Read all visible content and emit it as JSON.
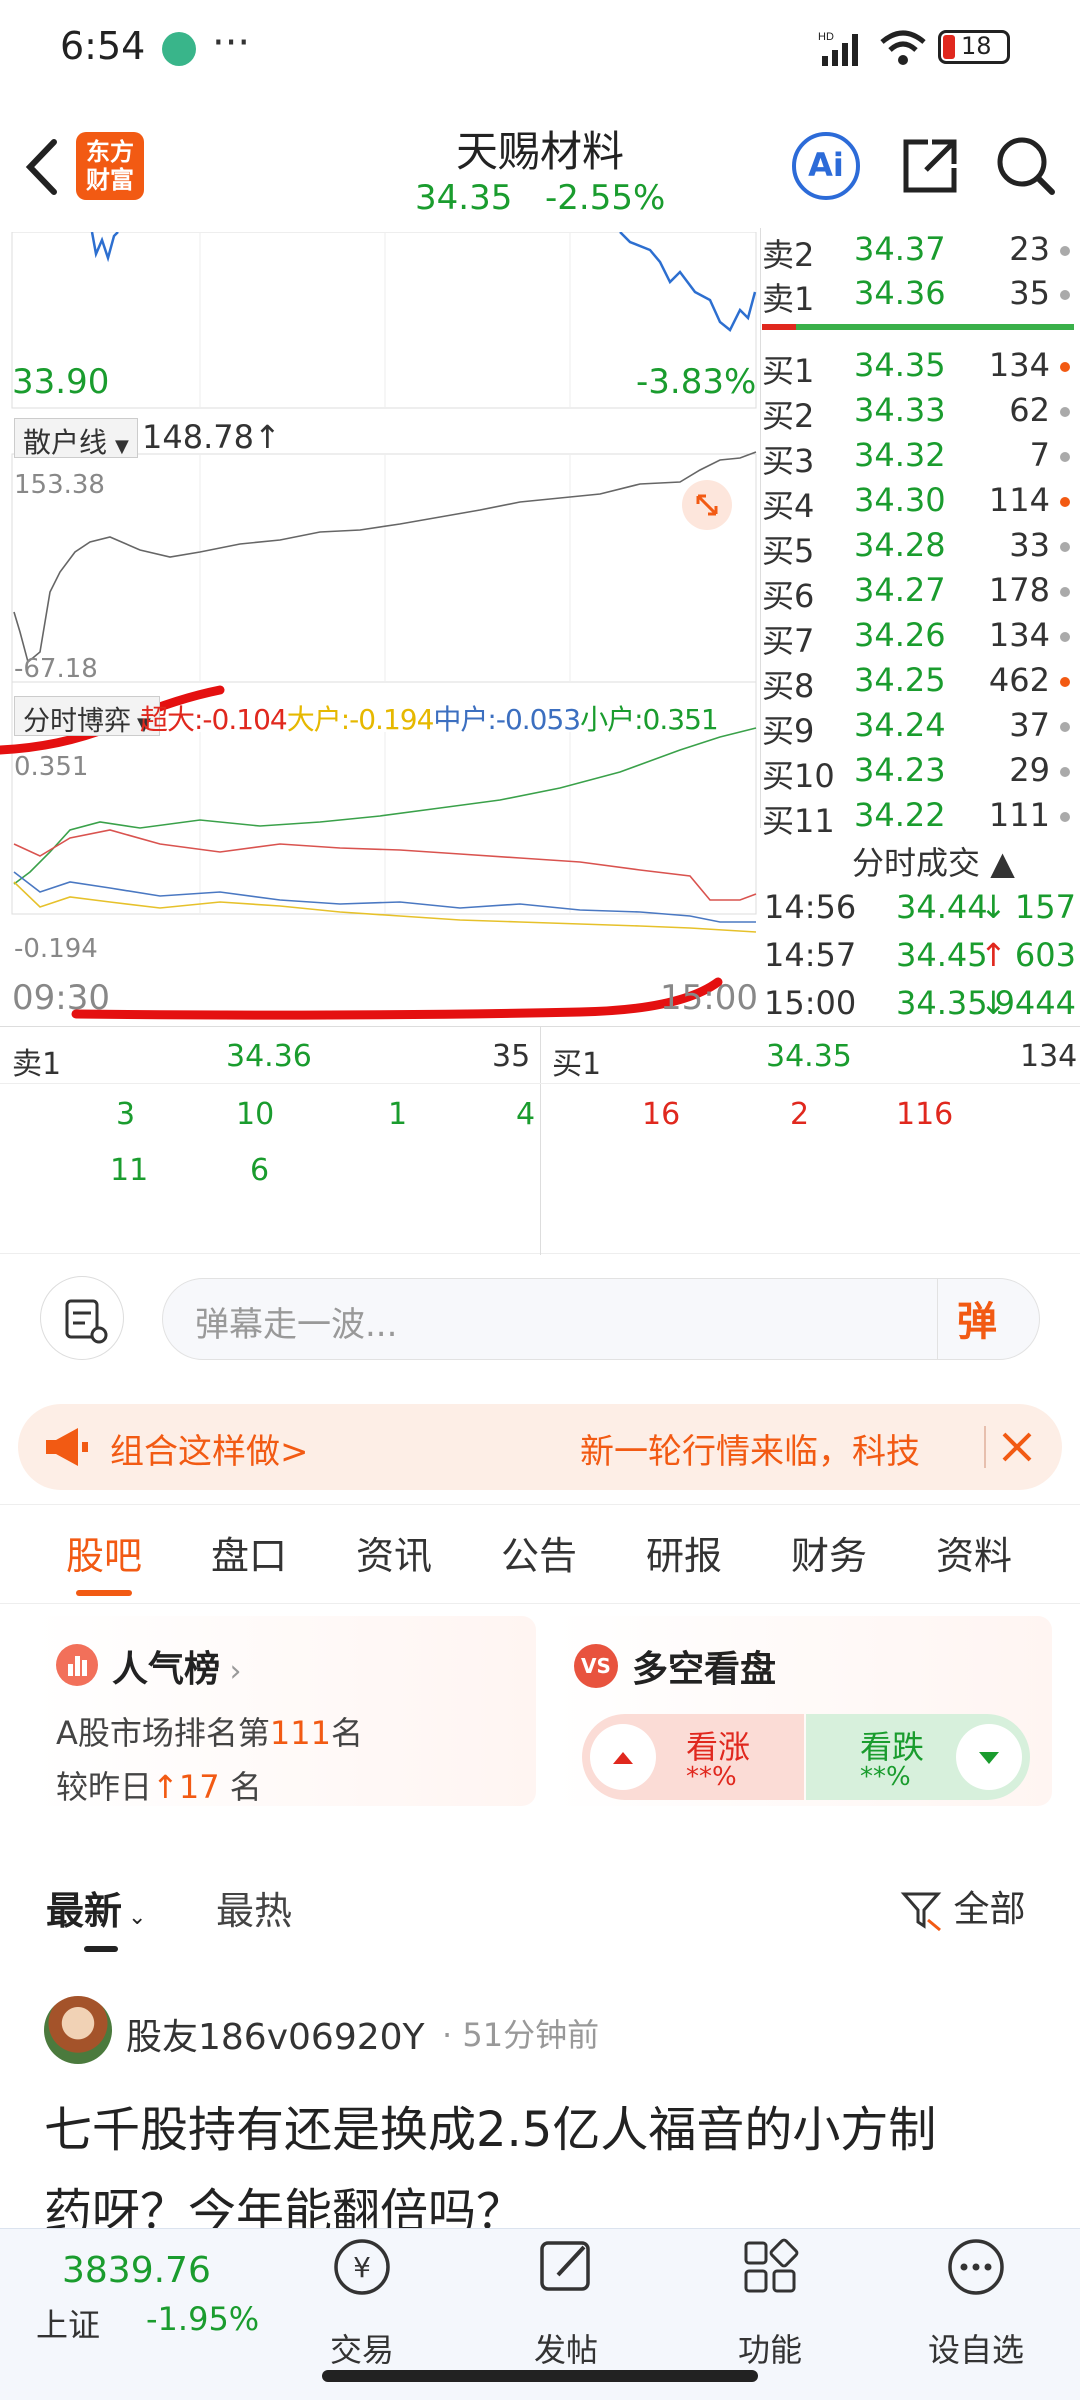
{
  "status_bar": {
    "time": "6:54",
    "dots": "···",
    "battery": "18"
  },
  "header": {
    "title": "天赐材料",
    "price": "34.35",
    "change": "-2.55%",
    "logo_line1": "东方",
    "logo_line2": "财富",
    "ai_label": "Ai"
  },
  "price_chart": {
    "low_price": "33.90",
    "low_pct": "-3.83%"
  },
  "retail_panel": {
    "selector_label": "散户线",
    "value": "148.78",
    "arrow": "↑",
    "top_value": "153.38",
    "bottom_value": "-67.18"
  },
  "flow_panel": {
    "selector_label": "分时博弈",
    "super_label": "超大:-0.104",
    "big_label": "大户:-0.194",
    "mid_label": "中户:-0.053",
    "small_label": "小户:0.351",
    "top_value": "0.351",
    "bottom_value": "-0.194",
    "time_start": "09:30",
    "time_end": "15:00"
  },
  "order_book": {
    "asks": [
      {
        "label": "卖2",
        "price": "34.37",
        "volume": "23",
        "dot": "grey"
      },
      {
        "label": "卖1",
        "price": "34.36",
        "volume": "35",
        "dot": "grey"
      }
    ],
    "bids": [
      {
        "label": "买1",
        "price": "34.35",
        "volume": "134",
        "dot": "orange"
      },
      {
        "label": "买2",
        "price": "34.33",
        "volume": "62",
        "dot": "grey"
      },
      {
        "label": "买3",
        "price": "34.32",
        "volume": "7",
        "dot": "grey"
      },
      {
        "label": "买4",
        "price": "34.30",
        "volume": "114",
        "dot": "orange"
      },
      {
        "label": "买5",
        "price": "34.28",
        "volume": "33",
        "dot": "grey"
      },
      {
        "label": "买6",
        "price": "34.27",
        "volume": "178",
        "dot": "grey"
      },
      {
        "label": "买7",
        "price": "34.26",
        "volume": "134",
        "dot": "grey"
      },
      {
        "label": "买8",
        "price": "34.25",
        "volume": "462",
        "dot": "orange"
      },
      {
        "label": "买9",
        "price": "34.24",
        "volume": "37",
        "dot": "grey"
      },
      {
        "label": "买10",
        "price": "34.23",
        "volume": "29",
        "dot": "grey"
      },
      {
        "label": "买11",
        "price": "34.22",
        "volume": "111",
        "dot": "grey"
      }
    ]
  },
  "ticks": {
    "title": "分时成交",
    "rows": [
      {
        "time": "14:56",
        "price": "34.44",
        "arrow": "↓",
        "volume": "157"
      },
      {
        "time": "14:57",
        "price": "34.45",
        "arrow": "↑",
        "volume": "603"
      },
      {
        "time": "15:00",
        "price": "34.35",
        "arrow": "↓",
        "volume": "9444"
      }
    ]
  },
  "sell_queue": {
    "label": "卖1",
    "price": "34.36",
    "volume": "35",
    "orders_row1": [
      "3",
      "10",
      "1",
      "4"
    ],
    "orders_row2": [
      "11",
      "6"
    ]
  },
  "buy_queue": {
    "label": "买1",
    "price": "34.35",
    "volume": "134",
    "orders_row1": [
      "16",
      "2",
      "116"
    ]
  },
  "danmaku": {
    "placeholder": "弹幕走一波...",
    "button_label": "弹"
  },
  "promo": {
    "left_text": "组合这样做>",
    "right_text": "新一轮行情来临，科技"
  },
  "tabs": [
    "股吧",
    "盘口",
    "资讯",
    "公告",
    "研报",
    "财务",
    "资料"
  ],
  "popularity": {
    "title": "人气榜",
    "rank_prefix": "A股市场排名第",
    "rank": "111",
    "rank_suffix": "名",
    "change_prefix": "较昨日",
    "change_arrow": "↑",
    "change_value": "17",
    "change_suffix": "名"
  },
  "sentiment": {
    "title": "多空看盘",
    "bull_label": "看涨",
    "bull_value": "**%",
    "bear_label": "看跌",
    "bear_value": "**%",
    "vs_label": "VS"
  },
  "feed": {
    "sort_latest": "最新",
    "sort_hot": "最热",
    "filter_label": "全部",
    "post": {
      "author": "股友186v06920Y",
      "time": "51分钟前",
      "line1": "七千股持有还是换成2.5亿人福音的小方制",
      "line2": "药呀？今年能翻倍吗？"
    }
  },
  "footer": {
    "index_value": "3839.76",
    "index_name": "上证",
    "index_change": "-1.95%",
    "items": [
      "交易",
      "发帖",
      "功能",
      "设自选"
    ],
    "trade_icon_glyph": "¥"
  }
}
